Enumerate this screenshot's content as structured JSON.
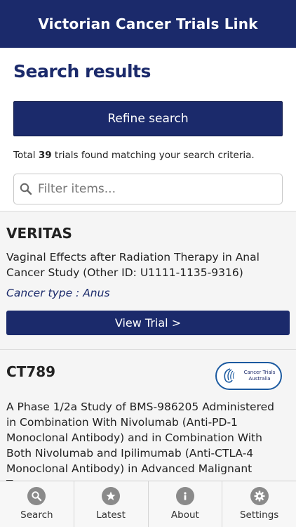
{
  "app": {
    "title": "Victorian Cancer Trials Link"
  },
  "page": {
    "title": "Search results"
  },
  "refine": {
    "label": "Refine search"
  },
  "summary": {
    "prefix": "Total",
    "count": "39",
    "suffix": "trials found matching your search criteria."
  },
  "filter": {
    "placeholder": "Filter items..."
  },
  "trials": [
    {
      "id": "VERITAS",
      "description": "Vaginal Effects after Radiation Therapy in Anal Cancer Study (Other ID: U1111-1135-9316)",
      "cancer_type": "Cancer type : Anus",
      "button": "View Trial >"
    },
    {
      "id": "CT789",
      "description": "A Phase 1/2a Study of BMS-986205 Administered in Combination With Nivolumab (Anti-PD-1 Monoclonal Antibody) and in Combination With Both Nivolumab and Ipilimumab (Anti-CTLA-4 Monoclonal Antibody) in Advanced Malignant Tumors",
      "logo_text": "Cancer Trials Australia"
    }
  ],
  "tabs": [
    {
      "label": "Search",
      "icon": "search-icon"
    },
    {
      "label": "Latest",
      "icon": "star-icon"
    },
    {
      "label": "About",
      "icon": "info-icon"
    },
    {
      "label": "Settings",
      "icon": "gear-icon"
    }
  ],
  "colors": {
    "primary": "#1b2a6b",
    "background": "#f5f5f5",
    "icon_grey": "#8a8a8a"
  }
}
